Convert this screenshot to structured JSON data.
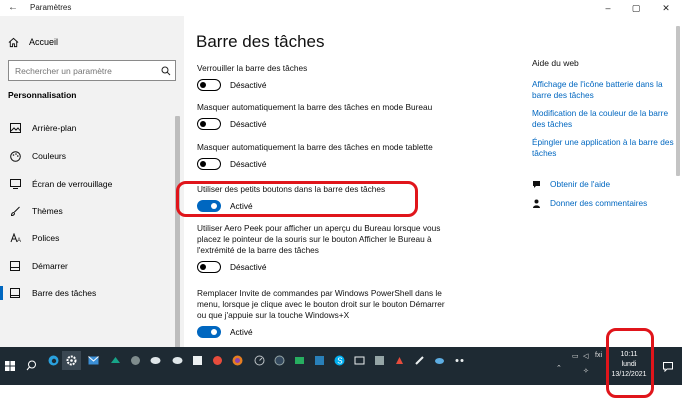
{
  "window": {
    "title": "Paramètres",
    "controls": [
      "–",
      "▢",
      "✕"
    ]
  },
  "sidebar": {
    "home_label": "Accueil",
    "search_placeholder": "Rechercher un paramètre",
    "section": "Personnalisation",
    "items": [
      {
        "label": "Arrière-plan",
        "icon": "image-icon"
      },
      {
        "label": "Couleurs",
        "icon": "palette-icon"
      },
      {
        "label": "Écran de verrouillage",
        "icon": "monitor-lock-icon"
      },
      {
        "label": "Thèmes",
        "icon": "brush-icon"
      },
      {
        "label": "Polices",
        "icon": "font-icon"
      },
      {
        "label": "Démarrer",
        "icon": "start-grid-icon"
      },
      {
        "label": "Barre des tâches",
        "icon": "taskbar-icon",
        "active": true
      }
    ]
  },
  "main": {
    "title": "Barre des tâches",
    "settings": [
      {
        "label": "Verrouiller la barre des tâches",
        "state": "Désactivé",
        "on": false
      },
      {
        "label": "Masquer automatiquement la barre des tâches en mode Bureau",
        "state": "Désactivé",
        "on": false
      },
      {
        "label": "Masquer automatiquement la barre des tâches en mode tablette",
        "state": "Désactivé",
        "on": false
      },
      {
        "label": "Utiliser des petits boutons dans la barre des tâches",
        "state": "Activé",
        "on": true
      },
      {
        "label": "Utiliser Aero Peek pour afficher un aperçu du Bureau lorsque vous placez le pointeur de la souris sur le bouton Afficher le Bureau à l'extrémité de la barre des tâches",
        "state": "Désactivé",
        "on": false
      },
      {
        "label": "Remplacer Invite de commandes par Windows PowerShell dans le menu, lorsque je clique avec le bouton droit sur le bouton Démarrer ou que j'appuie sur la touche Windows+X",
        "state": "Activé",
        "on": true
      }
    ]
  },
  "help": {
    "title": "Aide du web",
    "links": [
      "Affichage de l'icône batterie dans la barre des tâches",
      "Modification de la couleur de la barre des tâches",
      "Épingler une application à la barre des tâches"
    ],
    "get_help": "Obtenir de l'aide",
    "feedback": "Donner des commentaires"
  },
  "taskbar": {
    "time": "10:11",
    "day": "lundi",
    "date": "13/12/2021",
    "tray_label": "fxi"
  },
  "colors": {
    "accent": "#0067c0",
    "highlight": "#e0151b",
    "taskbar": "#1e2a33",
    "sidebar": "#f2f2f2"
  }
}
